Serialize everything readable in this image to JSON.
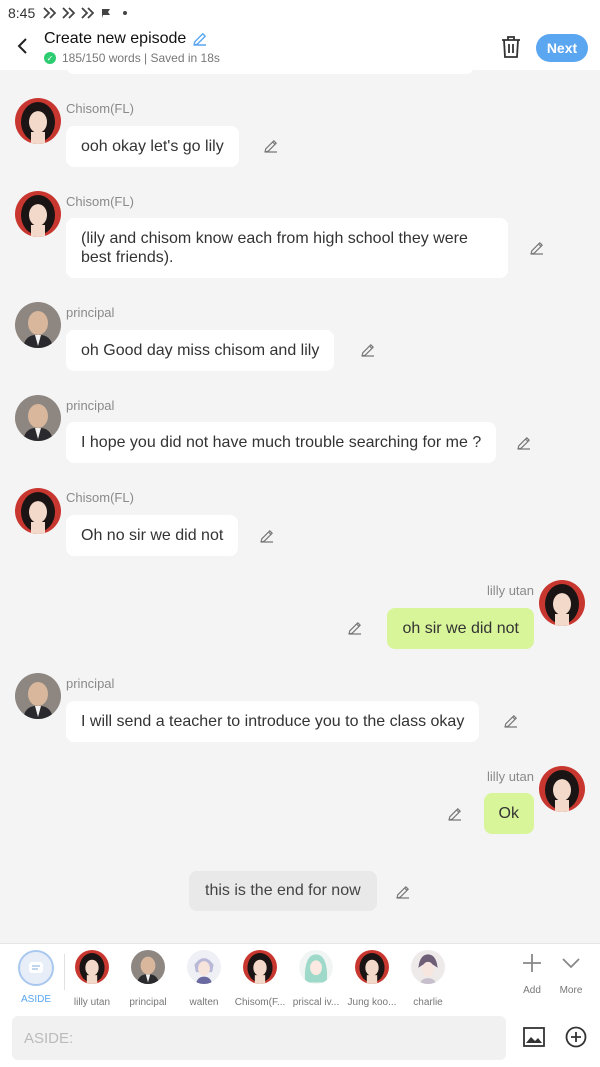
{
  "status_bar": {
    "time": "8:45"
  },
  "header": {
    "title": "Create new episode",
    "subtitle": "185/150 words | Saved in 18s",
    "next_label": "Next"
  },
  "messages": [
    {
      "id": "m1",
      "side": "left",
      "speaker": "Chisom(FL)",
      "text": "ooh okay let's go lily"
    },
    {
      "id": "m2",
      "side": "left",
      "speaker": "Chisom(FL)",
      "text": "(lily and chisom know each from high school they were best friends)."
    },
    {
      "id": "m3",
      "side": "left",
      "speaker": "principal",
      "text": "oh Good day miss chisom and lily"
    },
    {
      "id": "m4",
      "side": "left",
      "speaker": "principal",
      "text": "I hope you did not have much trouble searching for me ?"
    },
    {
      "id": "m5",
      "side": "left",
      "speaker": "Chisom(FL)",
      "text": "Oh no sir we did not"
    },
    {
      "id": "m6",
      "side": "right",
      "speaker": "lilly utan",
      "text": "oh sir we did not"
    },
    {
      "id": "m7",
      "side": "left",
      "speaker": "principal",
      "text": "I will send a teacher to introduce you to the class okay"
    },
    {
      "id": "m8",
      "side": "right",
      "speaker": "lilly utan",
      "text": "Ok"
    },
    {
      "id": "m9",
      "side": "aside",
      "speaker": "",
      "text": "this is the end for now"
    }
  ],
  "characters": [
    {
      "label": "ASIDE",
      "icon": "aside-icon"
    },
    {
      "label": "lilly utan",
      "icon": "avatar-dark-hair"
    },
    {
      "label": "principal",
      "icon": "avatar-bald"
    },
    {
      "label": "walten",
      "icon": "avatar-silver-hair"
    },
    {
      "label": "Chisom(F...",
      "icon": "avatar-dark-hair"
    },
    {
      "label": "priscal iv...",
      "icon": "avatar-teal-hair"
    },
    {
      "label": "Jung koo...",
      "icon": "avatar-dark-hair"
    },
    {
      "label": "charlie",
      "icon": "avatar-pale"
    }
  ],
  "tools": {
    "add_label": "Add",
    "more_label": "More"
  },
  "input": {
    "placeholder": "ASIDE:"
  },
  "colors": {
    "accent": "#5aa6f0",
    "right_bubble": "#d9f59a",
    "left_bubble": "#ffffff",
    "background": "#f4f4f5"
  }
}
